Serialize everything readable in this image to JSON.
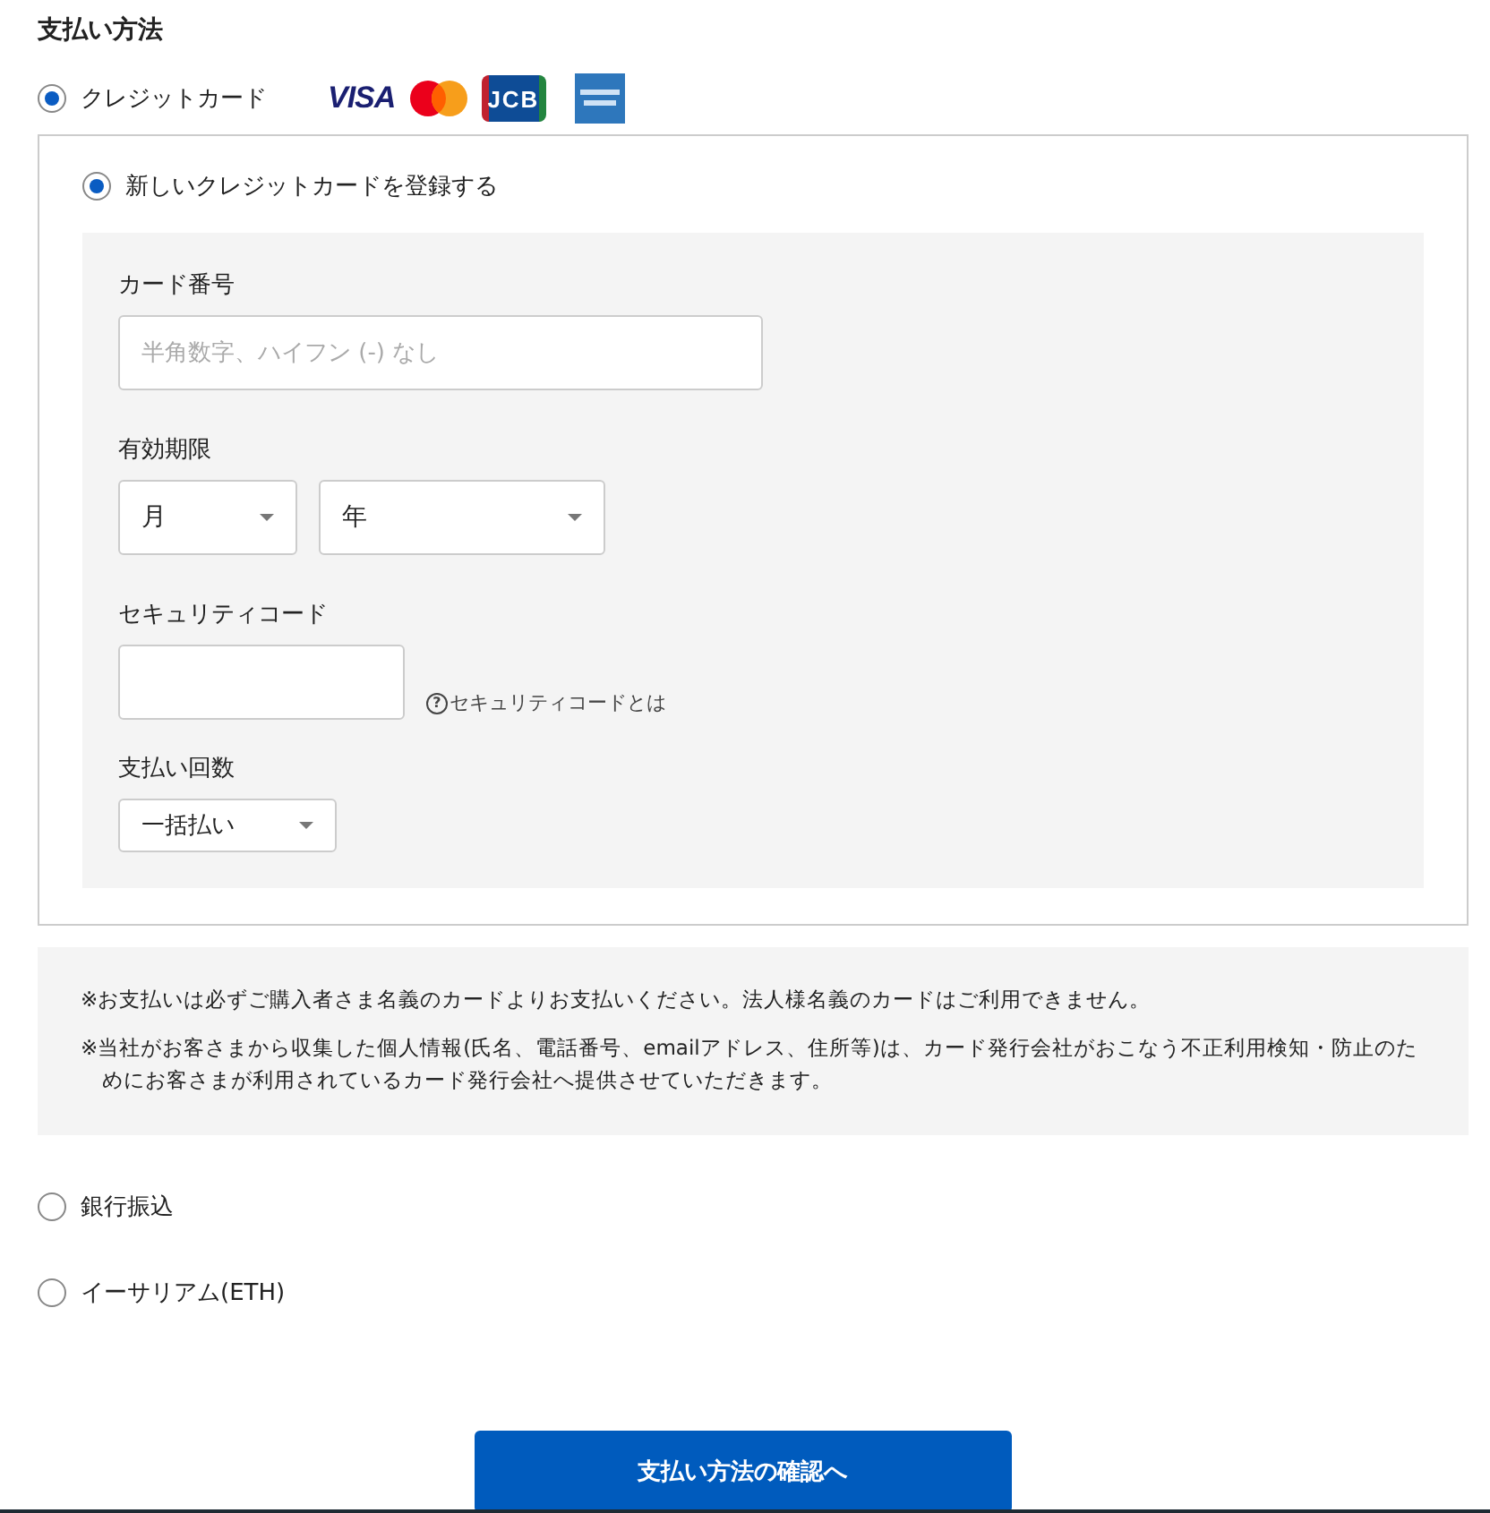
{
  "title": "支払い方法",
  "methods": [
    {
      "kind": "card",
      "label": "クレジットカード",
      "selected": true,
      "brands": [
        {
          "kind": "visa",
          "label": "VISA"
        },
        {
          "kind": "mastercard"
        },
        {
          "kind": "jcb",
          "label": "JCB"
        },
        {
          "kind": "amex"
        }
      ],
      "options": [
        {
          "label": "新しいクレジットカードを登録する",
          "selected": true
        }
      ],
      "form": {
        "card_number": {
          "label": "カード番号",
          "placeholder": "半角数字、ハイフン (-) なし"
        },
        "expiry": {
          "label": "有効期限",
          "month": "月",
          "year": "年"
        },
        "security": {
          "label": "セキュリティコード",
          "help_icon": "?",
          "help": "セキュリティコードとは"
        },
        "installments": {
          "label": "支払い回数",
          "value": "一括払い"
        }
      },
      "notes": [
        "※お支払いは必ずご購入者さま名義のカードよりお支払いください。法人様名義のカードはご利用できません。",
        "※当社がお客さまから収集した個人情報(氏名、電話番号、emailアドレス、住所等)は、カード発行会社がおこなう不正利用検知・防止のためにお客さまが利用されているカード発行会社へ提供させていただきます。"
      ]
    },
    {
      "kind": "plain",
      "label": "銀行振込",
      "selected": false
    },
    {
      "kind": "plain",
      "label": "イーサリアム(ETH)",
      "selected": false
    }
  ],
  "submit": "支払い方法の確認へ"
}
